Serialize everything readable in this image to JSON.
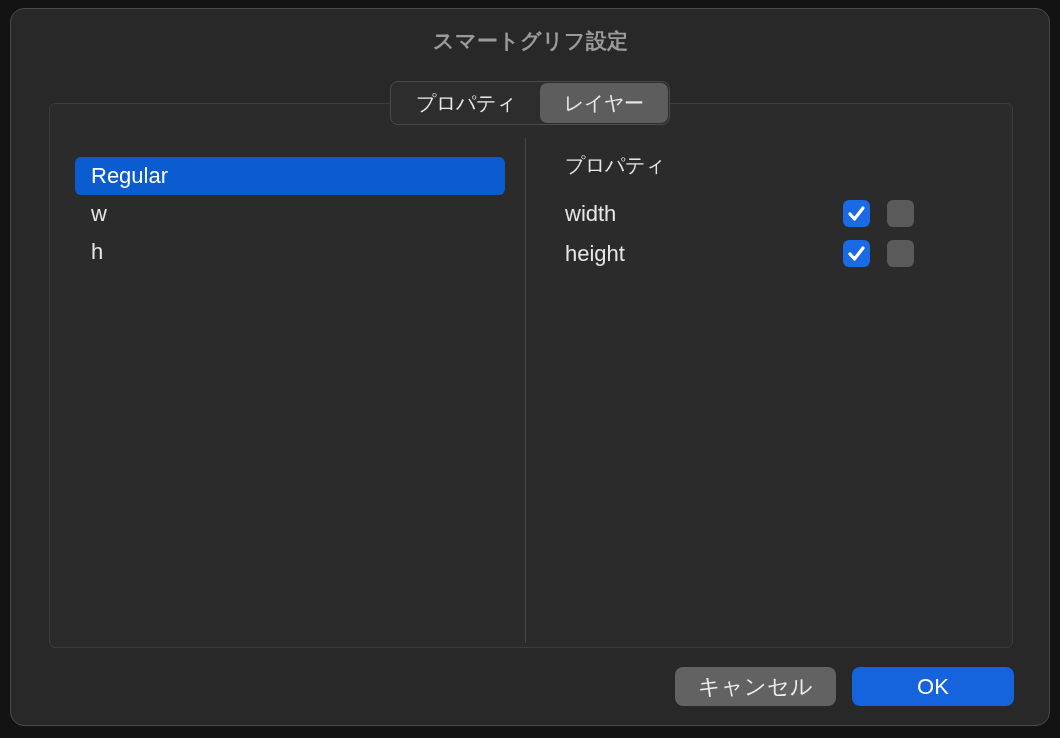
{
  "window": {
    "title": "スマートグリフ設定"
  },
  "tabs": [
    {
      "label": "プロパティ",
      "selected": false
    },
    {
      "label": "レイヤー",
      "selected": true
    }
  ],
  "layers": [
    {
      "name": "Regular",
      "selected": true
    },
    {
      "name": "w",
      "selected": false
    },
    {
      "name": "h",
      "selected": false
    }
  ],
  "properties": {
    "heading": "プロパティ",
    "rows": [
      {
        "name": "width",
        "checks": [
          {
            "checked": true
          },
          {
            "checked": false
          }
        ]
      },
      {
        "name": "height",
        "checks": [
          {
            "checked": true
          },
          {
            "checked": false
          }
        ]
      }
    ]
  },
  "buttons": [
    {
      "label": "キャンセル",
      "kind": "secondary"
    },
    {
      "label": "OK",
      "kind": "primary"
    }
  ]
}
